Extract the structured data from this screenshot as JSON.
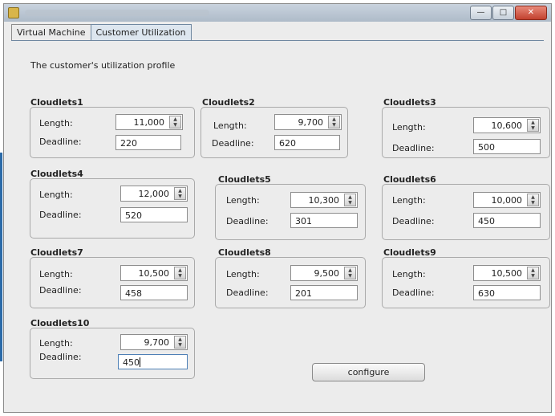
{
  "tabs": [
    {
      "label": "Virtual Machine"
    },
    {
      "label": "Customer Utilization",
      "active": true
    }
  ],
  "profile_label": "The customer's utilization profile",
  "cloudlets": [
    {
      "title": "Cloudlets1",
      "length_label": "Length:",
      "length": "11,000",
      "deadline_label": "Deadline:",
      "deadline": "220"
    },
    {
      "title": "Cloudlets2",
      "length_label": "Length:",
      "length": "9,700",
      "deadline_label": "Deadline:",
      "deadline": "620"
    },
    {
      "title": "Cloudlets3",
      "length_label": "Length:",
      "length": "10,600",
      "deadline_label": "Deadline:",
      "deadline": "500"
    },
    {
      "title": "Cloudlets4",
      "length_label": "Length:",
      "length": "12,000",
      "deadline_label": "Deadline:",
      "deadline": "520"
    },
    {
      "title": "Cloudlets5",
      "length_label": "Length:",
      "length": "10,300",
      "deadline_label": "Deadline:",
      "deadline": "301"
    },
    {
      "title": "Cloudlets6",
      "length_label": "Length:",
      "length": "10,000",
      "deadline_label": "Deadline:",
      "deadline": "450"
    },
    {
      "title": "Cloudlets7",
      "length_label": "Length:",
      "length": "10,500",
      "deadline_label": "Deadline:",
      "deadline": "458"
    },
    {
      "title": "Cloudlets8",
      "length_label": "Length:",
      "length": "9,500",
      "deadline_label": "Deadline:",
      "deadline": "201"
    },
    {
      "title": "Cloudlets9",
      "length_label": "Length:",
      "length": "10,500",
      "deadline_label": "Deadline:",
      "deadline": "630"
    },
    {
      "title": "Cloudlets10",
      "length_label": "Length:",
      "length": "9,700",
      "deadline_label": "Deadline:",
      "deadline": "450"
    }
  ],
  "configure_label": "configure",
  "window_buttons": {
    "minimize": "—",
    "maximize": "□",
    "close": "✕"
  }
}
